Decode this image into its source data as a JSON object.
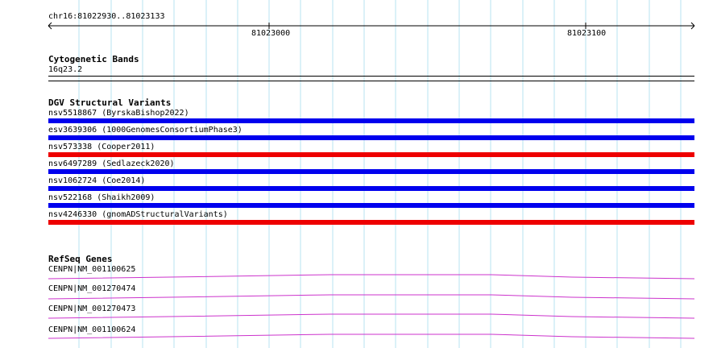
{
  "ruler": {
    "location": "chr16:81022930..81023133",
    "ticks": [
      "81023000",
      "81023100"
    ]
  },
  "cytoband": {
    "title": "Cytogenetic Bands",
    "band": "16q23.2"
  },
  "dgv": {
    "title": "DGV Structural Variants",
    "items": [
      {
        "label": "nsv5518867 (ByrskaBishop2022)",
        "color": "#0000ee"
      },
      {
        "label": "esv3639306 (1000GenomesConsortiumPhase3)",
        "color": "#0000ee"
      },
      {
        "label": "nsv573338 (Cooper2011)",
        "color": "#ee0000"
      },
      {
        "label": "nsv6497289 (Sedlazeck2020)",
        "color": "#0000ee"
      },
      {
        "label": "nsv1062724 (Coe2014)",
        "color": "#0000ee"
      },
      {
        "label": "nsv522168 (Shaikh2009)",
        "color": "#0000ee"
      },
      {
        "label": "nsv4246330 (gnomADStructuralVariants)",
        "color": "#ee0000"
      }
    ]
  },
  "refseq": {
    "title": "RefSeq Genes",
    "genes": [
      {
        "label": "CENPN|NM_001100625"
      },
      {
        "label": "CENPN|NM_001270474"
      },
      {
        "label": "CENPN|NM_001270473"
      },
      {
        "label": "CENPN|NM_001100624"
      }
    ]
  },
  "colors": {
    "grid": "#b7e3f2",
    "intron": "#cc33cc",
    "loss": "#ee0000",
    "gain": "#0000ee"
  }
}
